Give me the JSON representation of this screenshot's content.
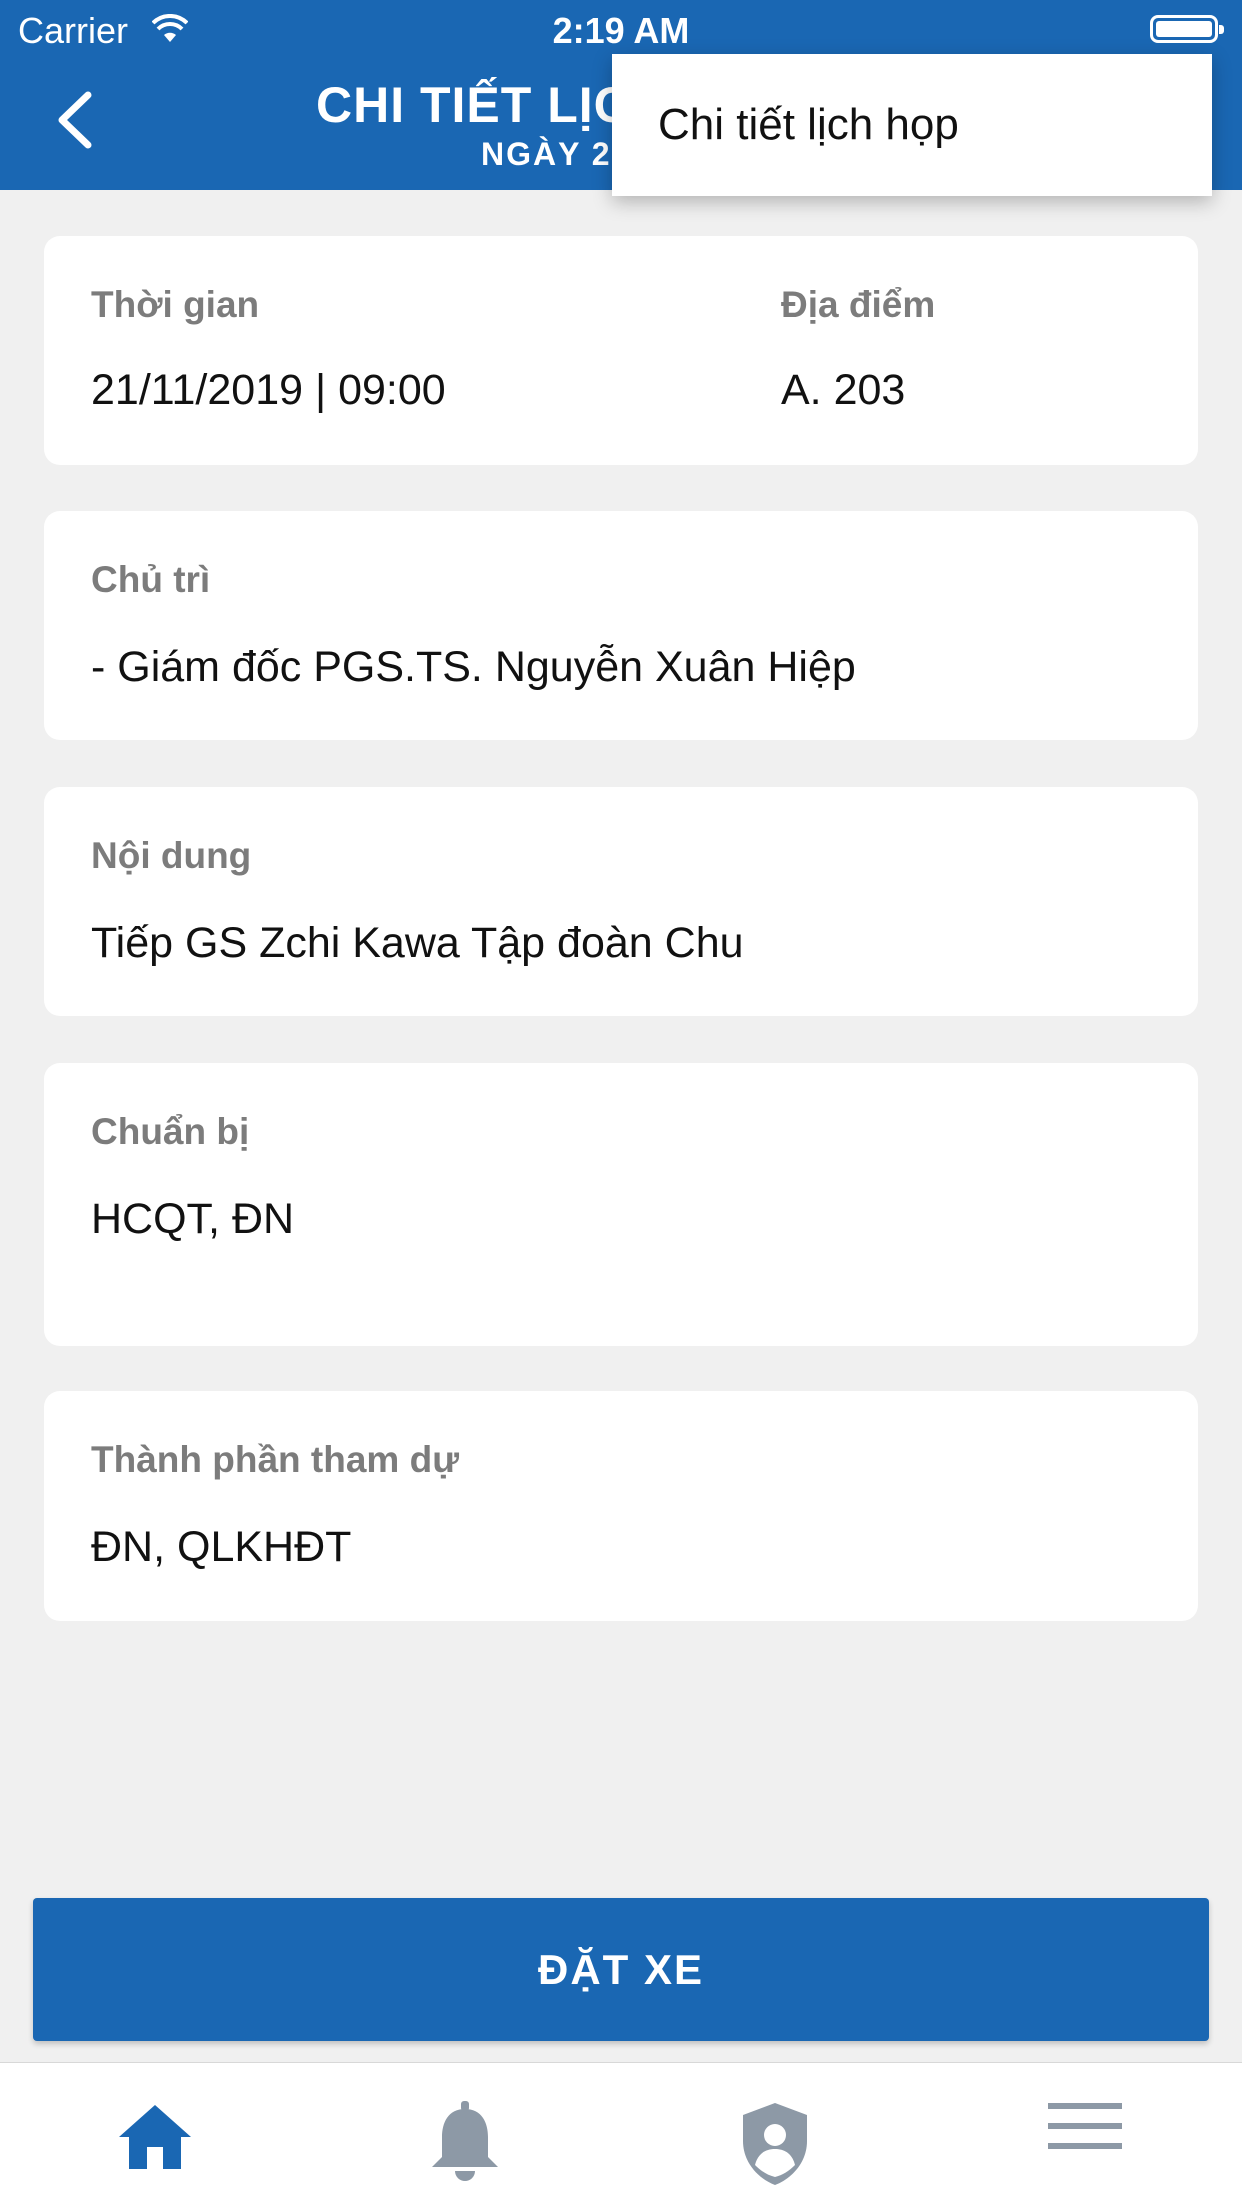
{
  "status_bar": {
    "carrier": "Carrier",
    "time": "2:19 AM"
  },
  "header": {
    "title": "CHI TIẾT LỊC",
    "subtitle": "NGÀY 21"
  },
  "popup_menu": {
    "item": "Chi tiết lịch họp"
  },
  "cards": {
    "time": {
      "label": "Thời gian",
      "value": "21/11/2019 | 09:00"
    },
    "location": {
      "label": "Địa điểm",
      "value": "A. 203"
    },
    "chair": {
      "label": "Chủ trì",
      "value": "- Giám đốc PGS.TS. Nguyễn Xuân Hiệp"
    },
    "content": {
      "label": "Nội dung",
      "value": "Tiếp GS Zchi Kawa Tập đoàn Chu"
    },
    "preparation": {
      "label": "Chuẩn bị",
      "value": "HCQT, ĐN"
    },
    "participants": {
      "label": "Thành phần tham dự",
      "value": "ĐN, QLKHĐT"
    }
  },
  "actions": {
    "book_car": "ĐẶT XE"
  },
  "tab_bar": {
    "tabs": [
      {
        "icon": "home-icon",
        "active": true
      },
      {
        "icon": "bell-icon",
        "active": false
      },
      {
        "icon": "shield-user-icon",
        "active": false
      },
      {
        "icon": "menu-icon",
        "active": false
      }
    ]
  },
  "colors": {
    "primary": "#1a67b3",
    "background": "#f0f0f0",
    "label": "#7c7c7c",
    "tab_inactive": "#8d99a6"
  }
}
